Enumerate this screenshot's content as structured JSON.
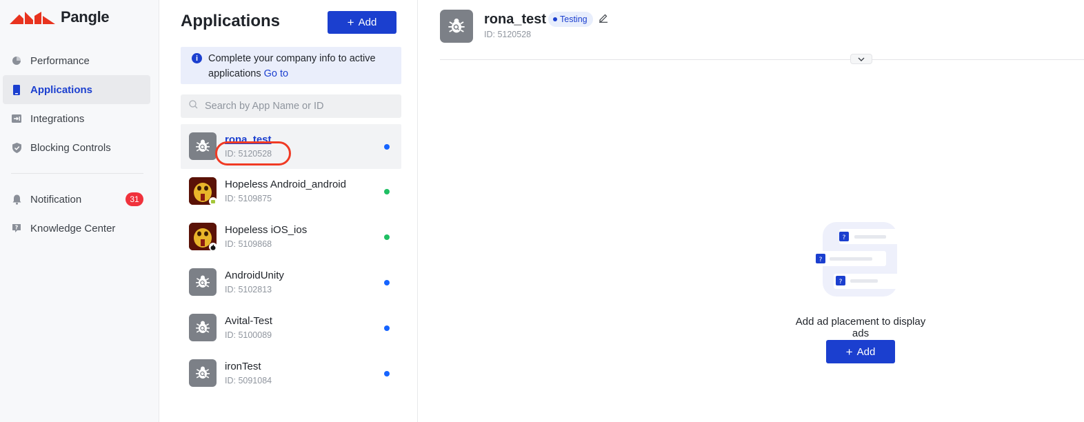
{
  "brand": {
    "name": "Pangle"
  },
  "sidebar": {
    "items": [
      {
        "label": "Performance",
        "icon": "pie-chart-icon"
      },
      {
        "label": "Applications",
        "icon": "phone-icon",
        "active": true
      },
      {
        "label": "Integrations",
        "icon": "import-icon"
      },
      {
        "label": "Blocking Controls",
        "icon": "shield-icon"
      },
      {
        "label": "Notification",
        "icon": "bell-icon",
        "badge": "31"
      },
      {
        "label": "Knowledge Center",
        "icon": "help-book-icon"
      }
    ]
  },
  "applications": {
    "title": "Applications",
    "add_label": "Add",
    "notice": {
      "text": "Complete your company info to active applications",
      "link": "Go to"
    },
    "search": {
      "placeholder": "Search by App Name or ID",
      "value": ""
    },
    "apps": [
      {
        "name": "rona_test",
        "id": "ID: 5120528",
        "icon": "debug-bug-icon",
        "status_color": "#1664ff",
        "selected": true
      },
      {
        "name": "Hopeless Android_android",
        "id": "ID: 5109875",
        "icon": "game-icon",
        "platform": "android-icon",
        "status_color": "#1fbf63"
      },
      {
        "name": "Hopeless iOS_ios",
        "id": "ID: 5109868",
        "icon": "game-icon",
        "platform": "apple-icon",
        "status_color": "#1fbf63"
      },
      {
        "name": "AndroidUnity",
        "id": "ID: 5102813",
        "icon": "debug-bug-icon",
        "status_color": "#1664ff"
      },
      {
        "name": "Avital-Test",
        "id": "ID: 5100089",
        "icon": "debug-bug-icon",
        "status_color": "#1664ff"
      },
      {
        "name": "ironTest",
        "id": "ID: 5091084",
        "icon": "debug-bug-icon",
        "status_color": "#1664ff"
      }
    ]
  },
  "detail": {
    "name": "rona_test",
    "status": "Testing",
    "id": "ID: 5120528",
    "empty_text": "Add ad placement to display ads",
    "add_label": "Add"
  },
  "colors": {
    "accent": "#1b3fcf",
    "badge": "#f0323c",
    "highlight": "#f03a24"
  }
}
